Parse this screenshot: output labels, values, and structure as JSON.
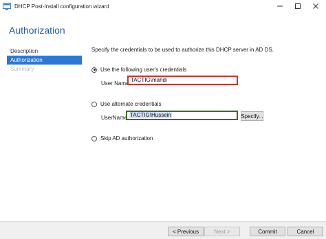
{
  "window": {
    "title": "DHCP Post-Install configuration wizard",
    "minimize_label": "minimize",
    "maximize_label": "maximize",
    "close_label": "close"
  },
  "header": {
    "heading": "Authorization"
  },
  "nav": {
    "items": [
      {
        "label": "Description",
        "state": "normal"
      },
      {
        "label": "Authorization",
        "state": "active"
      },
      {
        "label": "Summary",
        "state": "disabled"
      }
    ]
  },
  "content": {
    "intro": "Specify the credentials to be used to authorize this DHCP server in AD DS.",
    "option_user": {
      "label": "Use the following user's credentials",
      "selected": true,
      "field_label": "User Name:",
      "value": "TACTIG\\mahdi"
    },
    "option_alternate": {
      "label": "Use alternate credentials",
      "selected": false,
      "field_label": "UserName:",
      "value": "TACTIG\\Hussein",
      "specify_label": "Specify..."
    },
    "option_skip": {
      "label": "Skip AD authorization",
      "selected": false
    }
  },
  "footer": {
    "previous_label": "< Previous",
    "next_label": "Next >",
    "commit_label": "Commit",
    "cancel_label": "Cancel"
  },
  "colors": {
    "accent": "#2b78d4",
    "heading": "#1f5ea8",
    "highlight_red": "#d32f2f",
    "highlight_green": "#3b6e1e"
  }
}
